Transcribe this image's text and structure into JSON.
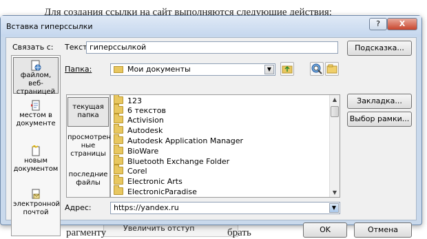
{
  "background": {
    "top_text": "Для создания ссылки на сайт выполняются следующие действия:",
    "bottom_text": "рагменту",
    "bottom_text_right": "брать",
    "menu_item": "Увеличить отступ"
  },
  "dialog": {
    "title": "Вставка гиперссылки",
    "help_label": "?",
    "close_label": "X"
  },
  "link_bar": {
    "label": "Связать с:",
    "items": [
      {
        "label": "файлом, веб-страницей",
        "icon": "web-page-icon"
      },
      {
        "label": "местом в документе",
        "icon": "place-in-document-icon"
      },
      {
        "label": "новым документом",
        "icon": "new-document-icon"
      },
      {
        "label": "электронной почтой",
        "icon": "email-icon"
      }
    ]
  },
  "text_field": {
    "label": "Текст:",
    "value": "гиперссылкой"
  },
  "hint_button": "Подсказка...",
  "folder_field": {
    "label": "Папка:",
    "value": "Мои документы"
  },
  "sub_bar": {
    "items": [
      {
        "label": "текущая папка"
      },
      {
        "label": "просмотрен-ные страницы"
      },
      {
        "label": "последние файлы"
      }
    ]
  },
  "file_list": [
    "123",
    "6 текстов",
    "Activision",
    "Autodesk",
    "Autodesk Application Manager",
    "BioWare",
    "Bluetooth Exchange Folder",
    "Corel",
    "Electronic Arts",
    "ElectronicParadise"
  ],
  "right_buttons": {
    "bookmark": "Закладка...",
    "target_frame": "Выбор рамки..."
  },
  "address_field": {
    "label": "Адрес:",
    "value": "https://yandex.ru"
  },
  "ok_button": "OK",
  "cancel_button": "Отмена",
  "colors": {
    "frame": "#c9d9ec",
    "client": "#f0f0f0",
    "folder": "#e8c760"
  }
}
